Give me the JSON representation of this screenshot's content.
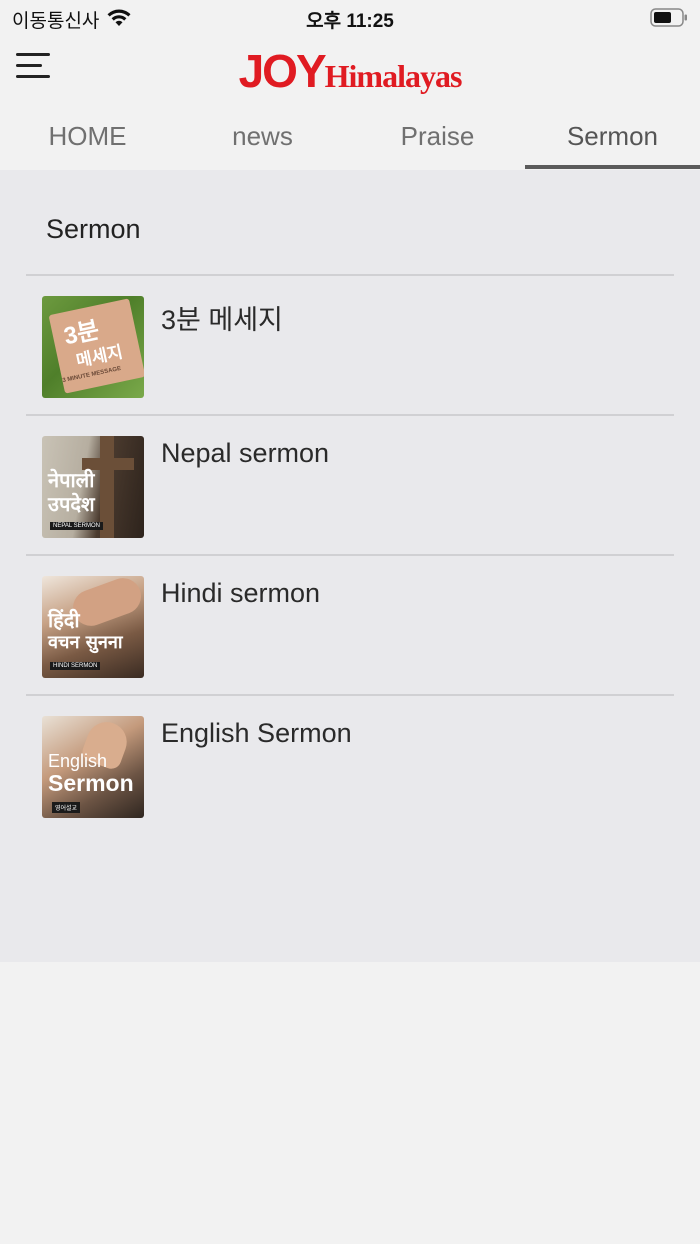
{
  "status_bar": {
    "carrier": "이동통신사",
    "time": "오후 11:25"
  },
  "header": {
    "logo_joy": "JOY",
    "logo_himalayas": "Himalayas",
    "brand_color": "#e01b22"
  },
  "tabs": [
    {
      "label": "HOME",
      "active": false
    },
    {
      "label": "news",
      "active": false
    },
    {
      "label": "Praise",
      "active": false
    },
    {
      "label": "Sermon",
      "active": true
    }
  ],
  "section": {
    "title": "Sermon"
  },
  "items": [
    {
      "label": "3분 메세지",
      "thumb_text": "3분",
      "thumb_text2": "메세지",
      "thumb_sub": "3 MINUTE MESSAGE"
    },
    {
      "label": "Nepal sermon",
      "thumb_text": "नेपाली",
      "thumb_text2": "उपदेश",
      "thumb_sub": "NEPAL SERMON"
    },
    {
      "label": "Hindi sermon",
      "thumb_text": "हिंदी",
      "thumb_text2": "वचन सुनना",
      "thumb_sub": "HINDI SERMON"
    },
    {
      "label": "English Sermon",
      "thumb_text": "English",
      "thumb_text2": "Sermon",
      "thumb_sub": "영어설교"
    }
  ]
}
